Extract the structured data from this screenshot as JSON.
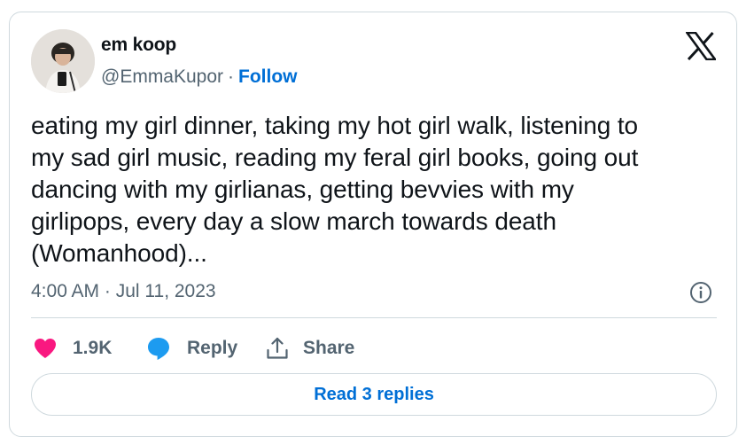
{
  "author": {
    "display_name": "em koop",
    "handle": "@EmmaKupor",
    "separator": "·",
    "follow_label": "Follow"
  },
  "tweet": {
    "text": "eating my girl dinner, taking my hot girl walk, listening to\nmy sad girl music, reading my feral girl books, going out\ndancing with my girlianas, getting bevvies with my\ngirlipops, every day a slow march towards death\n(Womanhood)...",
    "timestamp": "4:00 AM · Jul 11, 2023"
  },
  "actions": {
    "like_count": "1.9K",
    "reply_label": "Reply",
    "share_label": "Share"
  },
  "footer": {
    "read_replies_label": "Read 3 replies"
  },
  "icons": {
    "platform_logo": "x-logo-icon",
    "info": "info-icon",
    "like": "heart-icon",
    "reply": "speech-bubble-icon",
    "share": "share-upload-icon"
  },
  "colors": {
    "like": "#f91880",
    "reply": "#1d9bf0",
    "link": "#006fd6",
    "muted": "#536471",
    "border": "#cfd9de"
  }
}
